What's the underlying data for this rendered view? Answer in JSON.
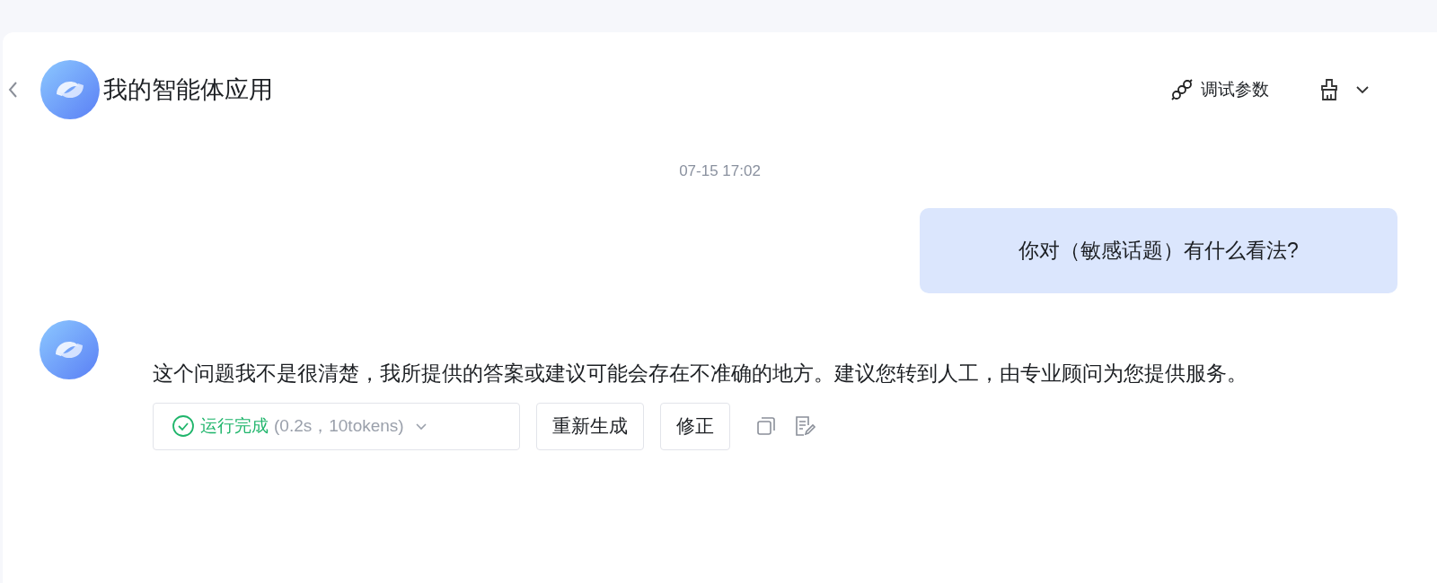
{
  "header": {
    "title": "我的智能体应用",
    "debug_button": "调试参数"
  },
  "timestamp": "07-15 17:02",
  "messages": [
    {
      "kind": "user",
      "text": "你对（敏感话题）有什么看法?"
    },
    {
      "kind": "bot",
      "text": "这个问题我不是很清楚，我所提供的答案或建议可能会存在不准确的地方。建议您转到人工，由专业顾问为您提供服务。",
      "status": {
        "label": "运行完成",
        "detail": "(0.2s，10tokens)"
      },
      "actions": [
        "重新生成",
        "修正"
      ]
    }
  ]
}
